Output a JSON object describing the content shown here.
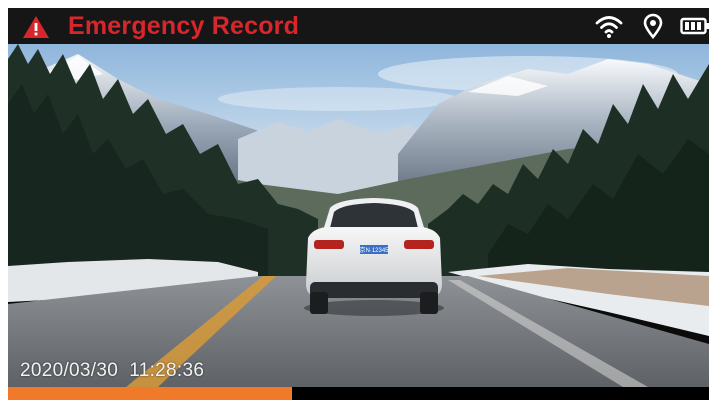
{
  "status_bar": {
    "title": "Emergency Record",
    "title_color": "#d7262c",
    "alert_icon": "warning-triangle-icon",
    "indicators": [
      "wifi-icon",
      "gps-location-icon",
      "battery-icon"
    ]
  },
  "camera_view": {
    "timestamp": "2020/03/30  11:28:36",
    "license_plate": "京N·12345"
  },
  "recording_progress": {
    "fraction": 0.405,
    "fill_color": "#f07a2a"
  }
}
